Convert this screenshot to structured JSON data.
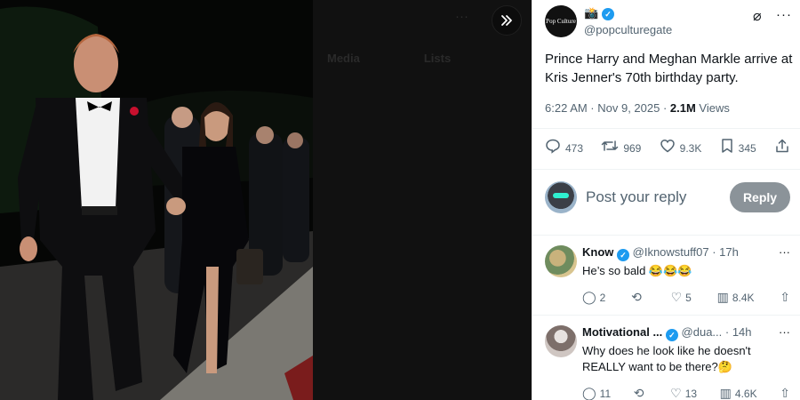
{
  "viewer": {
    "ghost_tabs": [
      "Media",
      "Lists"
    ],
    "collapse_icon": "chevrons-right-icon"
  },
  "tweet": {
    "handle": "@popculturegate",
    "avatar_text": "Pop Culture",
    "emoji": "📸",
    "text": "Prince Harry and Meghan Markle arrive at Kris Jenner's 70th birthday party.",
    "time": "6:22 AM · Nov 9, 2025 · ",
    "views_count": "2.1M",
    "views_label": " Views",
    "stats": {
      "replies": "473",
      "reposts": "969",
      "likes": "9.3K",
      "bookmarks": "345"
    }
  },
  "compose": {
    "placeholder": "Post your reply",
    "button": "Reply"
  },
  "replies": [
    {
      "name": "Know",
      "handle": "@Iknowstuff07 · 17h",
      "text": "He’s so bald 😂😂😂",
      "replies": "2",
      "reposts": "",
      "likes": "5",
      "views": "8.4K"
    },
    {
      "name": "Motivational ...",
      "handle": "@dua... · 14h",
      "text": "Why does he look like he doesn't REALLY want to be there?🤔",
      "replies": "11",
      "reposts": "",
      "likes": "13",
      "views": "4.6K"
    }
  ],
  "colors": {
    "accent": "#1d9bf0",
    "muted": "#536471",
    "reply_button": "#8b9399"
  }
}
